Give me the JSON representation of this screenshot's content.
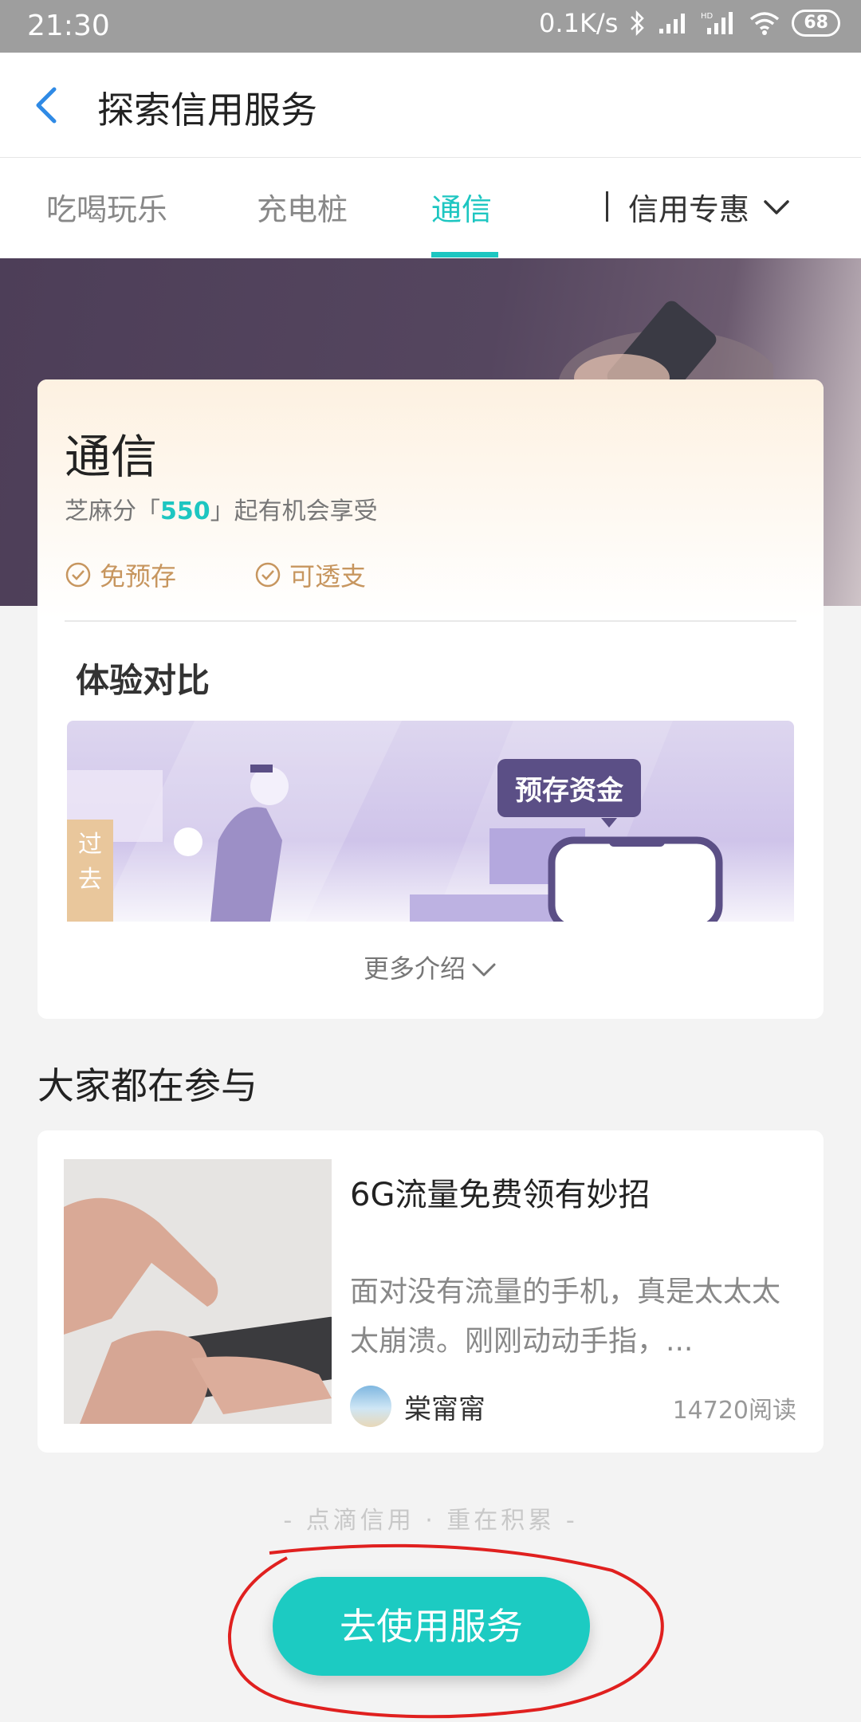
{
  "status_bar": {
    "time": "21:30",
    "net_speed": "0.1K/s",
    "battery": "68",
    "icons": [
      "bluetooth-icon",
      "signal-icon",
      "hd-signal-icon",
      "wifi-icon",
      "battery-icon"
    ]
  },
  "nav": {
    "title": "探索信用服务",
    "back_icon": "back-arrow-icon"
  },
  "tabs": {
    "items": [
      {
        "label": "吃喝玩乐",
        "active": false
      },
      {
        "label": "充电桩",
        "active": false
      },
      {
        "label": "通信",
        "active": true
      }
    ],
    "more_label": "信用专惠",
    "accent": "#1dc6c1"
  },
  "service": {
    "title": "通信",
    "subtitle_prefix": "芝麻分「",
    "score": "550",
    "subtitle_suffix": "」起有机会享受",
    "features": [
      "免预存",
      "可透支"
    ],
    "compare_title": "体验对比",
    "illus_bubble": "预存资金",
    "illus_past": "过去",
    "more_intro": "更多介绍"
  },
  "participate": {
    "section_title": "大家都在参与",
    "article": {
      "title": "6G流量免费领有妙招",
      "desc": "面对没有流量的手机，真是太太太太崩溃。刚刚动动手指，...",
      "author": "棠甯甯",
      "reads": "14720阅读"
    }
  },
  "footer": {
    "slogan": "- 点滴信用 · 重在积累 -",
    "cta_label": "去使用服务",
    "cta_color": "#1ccbc2"
  }
}
